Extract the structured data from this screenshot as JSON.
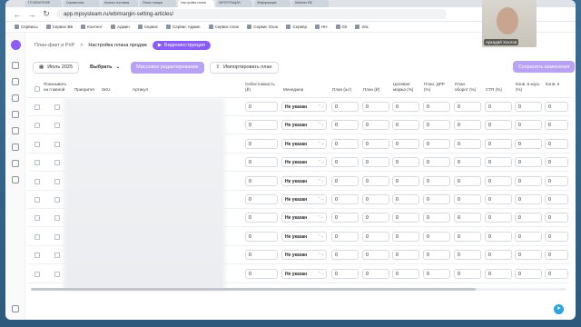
{
  "browser": {
    "tabs": [
      "ГП ВЕЧЕРНЕЕ",
      "Справочник",
      "Анализ поставок",
      "Поиск товара",
      "Настройка плана",
      "ИНТЕГРАЦИИ",
      "Информация",
      "Кабинет ВБ"
    ],
    "url": "app.mpsysteam.ru/wb/margin-setting-articles/",
    "bookmarks": [
      "Сервисы",
      "Сервис ВБ",
      "Контент",
      "Админ",
      "Сервис",
      "Сервис Админ",
      "Сервис план",
      "Сервис Озон",
      "Сервер",
      "HH",
      "Git",
      "Jira"
    ]
  },
  "camera": {
    "name": "Аркадий Хохлов"
  },
  "breadcrumbs": {
    "parent": "План-факт и PnP",
    "separator": ">",
    "current": "Настройка плана продаж"
  },
  "video_button": "Видеоинструкция",
  "controls": {
    "month": "Июль 2025",
    "choose": "Выбрать",
    "mass_edit": "Массовое редактирование",
    "import": "Импортировать план",
    "save": "Сохранить изменения"
  },
  "table": {
    "headers": {
      "show": "Показывать на главной",
      "priority": "Приоритет",
      "sku": "SKU",
      "article": "Артикул",
      "cost": "Себестоимость (₽)",
      "manager": "Менеджер",
      "plan_pcs": "План (шт)",
      "plan_rub": "План (₽)",
      "target_margin": "Целевая маржа (%)",
      "plan_drr": "План. ДРР (%)",
      "plan_turnover": "План. оборот (%)",
      "ctr": "CTR (%)",
      "conv_cart": "Конв. в корз. (%)",
      "conv_order": "Конв. в"
    },
    "row_count": 10,
    "row_values": {
      "priority": "0",
      "cost": "0",
      "manager": "Не указан",
      "plan_pcs": "0",
      "plan_rub": "0",
      "target_margin": "0",
      "plan_drr": "0",
      "plan_turnover": "0",
      "ctr": "0",
      "conv_cart": "0",
      "conv_order": "0"
    }
  },
  "colors": {
    "accent": "#8b5cf6",
    "accent_light": "#b8a2f3",
    "telegram": "#2aa3e0"
  }
}
